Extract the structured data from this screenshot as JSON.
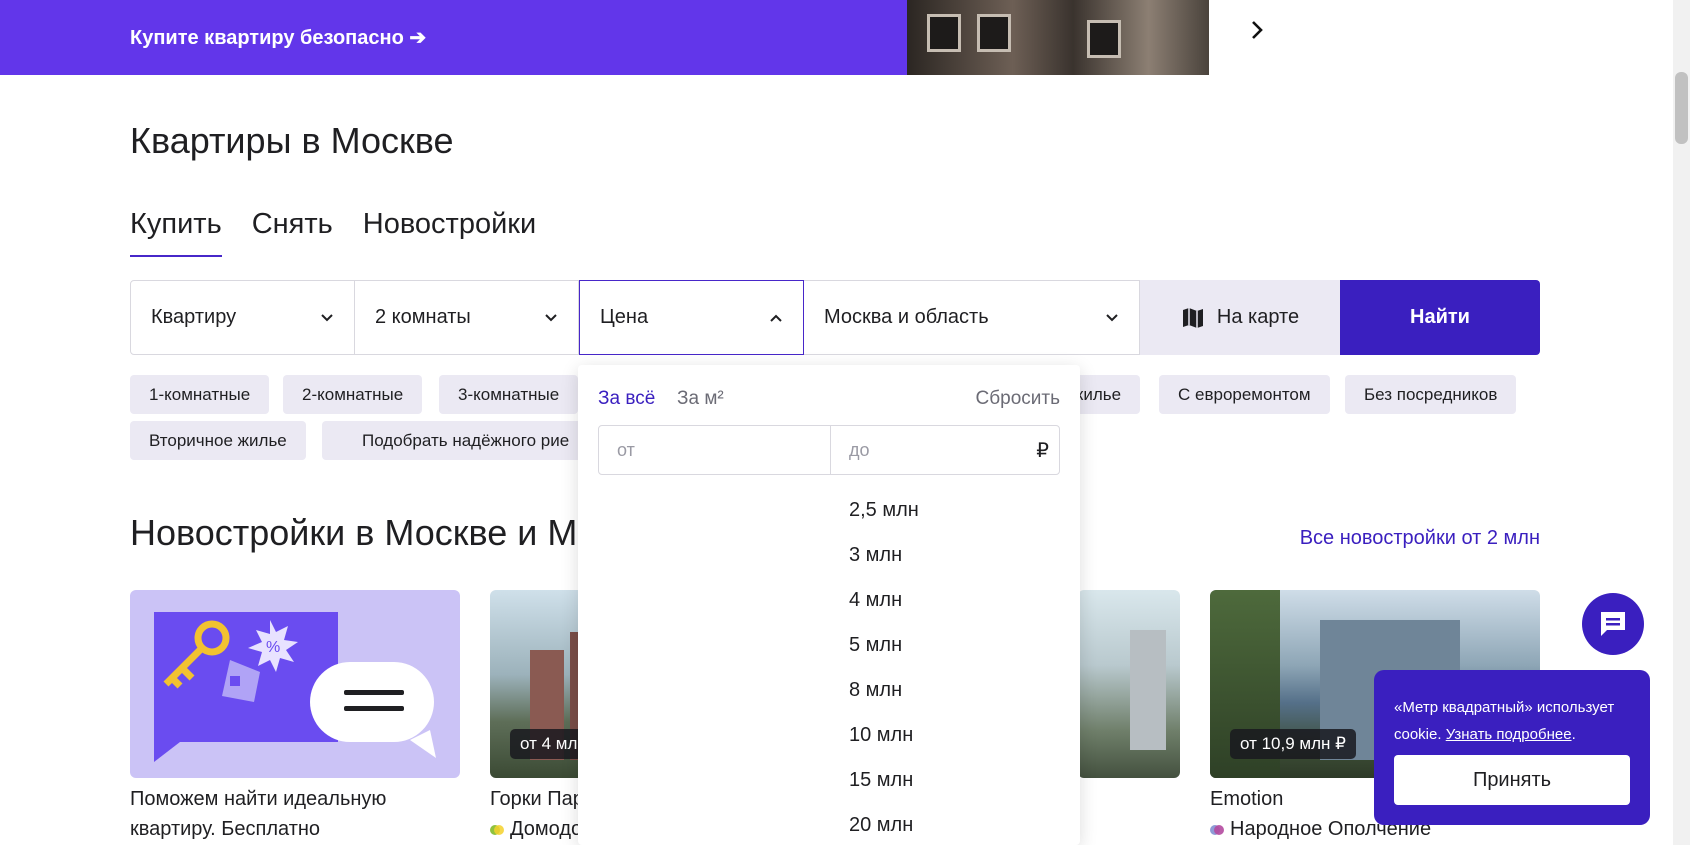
{
  "banner": {
    "text": "Купите квартиру безопасно ➔"
  },
  "page_title": "Квартиры в Москве",
  "tabs": [
    {
      "label": "Купить",
      "active": true
    },
    {
      "label": "Снять",
      "active": false
    },
    {
      "label": "Новостройки",
      "active": false
    }
  ],
  "search": {
    "type_value": "Квартиру",
    "rooms_value": "2 комнаты",
    "price_value": "Цена",
    "region_value": "Москва и область",
    "map_label": "На карте",
    "find_label": "Найти"
  },
  "chips": {
    "c1": "1-комнатные",
    "c2": "2-комнатные",
    "c3": "3-комнатные",
    "c4": "жилье",
    "c5": "С евроремонтом",
    "c6": "Без посредников",
    "c7": "Вторичное жилье",
    "c8": "Подобрать надёжного рие"
  },
  "section": {
    "title": "Новостройки в Москве и М",
    "all_link": "Все новостройки от 2 млн"
  },
  "cards": {
    "c1": {
      "title": "Поможем найти идеальную",
      "sub": "квартиру. Бесплатно"
    },
    "c2": {
      "price": "от 4 мл",
      "title": "Горки Пар",
      "metro": "Домодо"
    },
    "c4": {
      "price": "от 10,9 млн ₽",
      "title": "Emotion",
      "metro": "Народное Ополчение"
    }
  },
  "price_dropdown": {
    "tab_total": "За всё",
    "tab_sqm": "За м²",
    "reset": "Сбросить",
    "from_placeholder": "от",
    "to_placeholder": "до",
    "currency": "₽",
    "options": [
      "2,5 млн",
      "3 млн",
      "4 млн",
      "5 млн",
      "8 млн",
      "10 млн",
      "15 млн",
      "20 млн"
    ]
  },
  "cookie": {
    "text": "«Метр квадратный» использует cookie.",
    "link": "Узнать подробнее",
    "after_link": ".",
    "accept": "Принять"
  },
  "colors": {
    "accent": "#3a1fbf",
    "banner": "#6236ea",
    "chip_bg": "#ebe9f3"
  }
}
